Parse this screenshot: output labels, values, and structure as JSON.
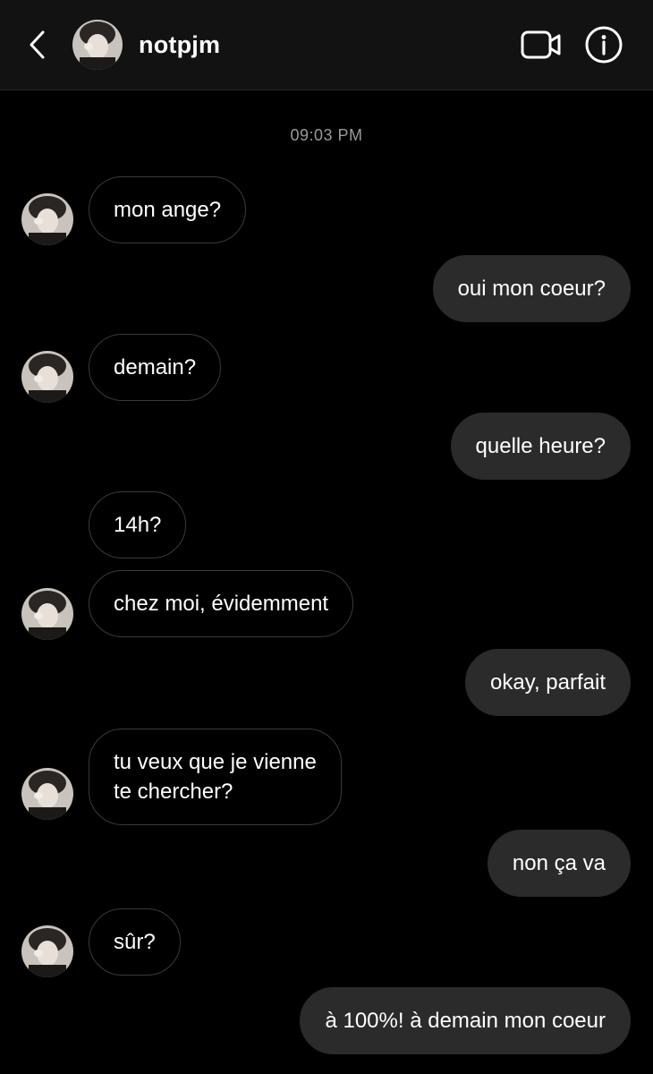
{
  "header": {
    "username": "notpjm",
    "back_icon": "chevron-left-icon",
    "video_icon": "video-camera-icon",
    "info_icon": "info-icon"
  },
  "colors": {
    "background": "#000000",
    "header_background": "#121212",
    "outgoing_bubble": "#2b2b2b",
    "incoming_border": "#3a3a3a",
    "timestamp_text": "#9a9a9a"
  },
  "conversation": {
    "timestamp": "09:03 PM",
    "messages": [
      {
        "from": "them",
        "text": "mon ange?"
      },
      {
        "from": "me",
        "text": "oui mon coeur?"
      },
      {
        "from": "them",
        "text": "demain?"
      },
      {
        "from": "me",
        "text": "quelle heure?"
      },
      {
        "from": "them",
        "text": "14h?"
      },
      {
        "from": "them",
        "text": "chez moi, évidemment"
      },
      {
        "from": "me",
        "text": "okay, parfait"
      },
      {
        "from": "them",
        "text": "tu veux que je vienne\nte chercher?"
      },
      {
        "from": "me",
        "text": "non ça va"
      },
      {
        "from": "them",
        "text": "sûr?"
      },
      {
        "from": "me",
        "text": "à 100%! à demain mon coeur"
      }
    ]
  }
}
